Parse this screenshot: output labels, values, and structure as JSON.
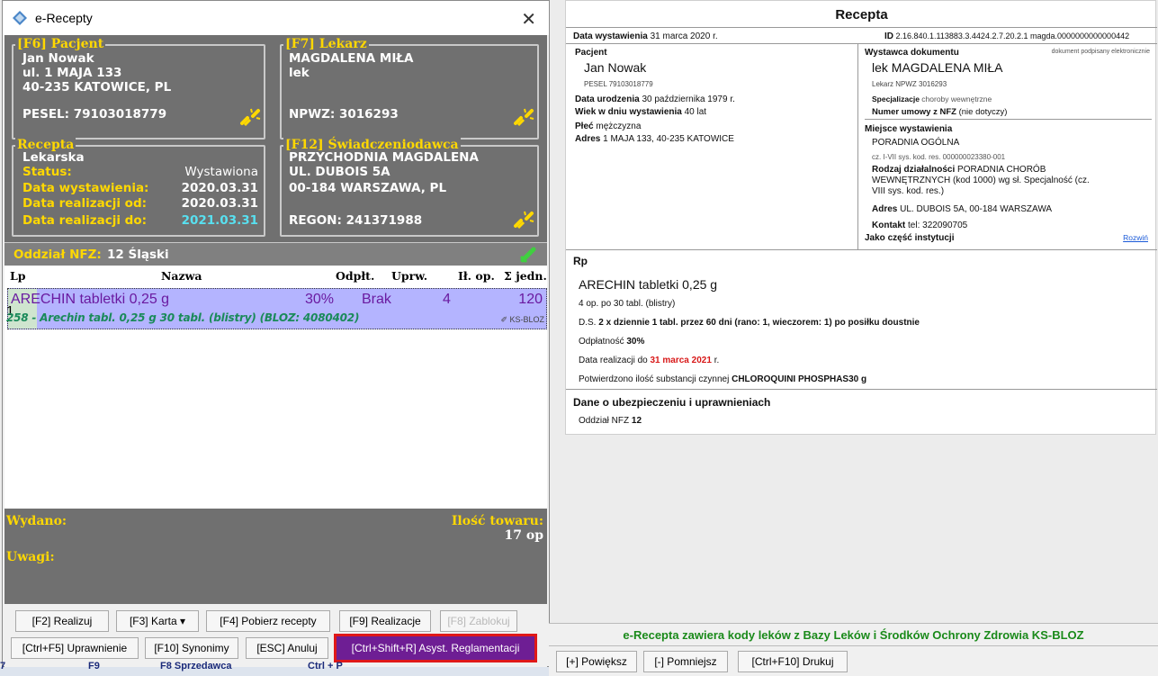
{
  "window": {
    "title": "e-Recepty"
  },
  "patient": {
    "legend": "[F6] Pacjent",
    "name": "Jan Nowak",
    "street": "ul. 1 MAJA 133",
    "city": "40-235 KATOWICE, PL",
    "pesel": "PESEL: 79103018779"
  },
  "doctor": {
    "legend": "[F7] Lekarz",
    "name": "MAGDALENA MIŁA",
    "title": "lek",
    "npwz": "NPWZ: 3016293"
  },
  "prescription": {
    "legend": "Recepta",
    "type": "Lekarska",
    "status_label": "Status:",
    "status_value": "Wystawiona",
    "issued_label": "Data wystawienia:",
    "issued_value": "2020.03.31",
    "from_label": "Data realizacji od:",
    "from_value": "2020.03.31",
    "to_label": "Data realizacji do:",
    "to_value": "2021.03.31"
  },
  "provider": {
    "legend": "[F12] Świadczeniodawca",
    "name": "PRZYCHODNIA MAGDALENA",
    "street": "UL. DUBOIS 5A",
    "city": "00-184 WARSZAWA, PL",
    "regon": "REGON: 241371988"
  },
  "nfz": {
    "label": "Oddział NFZ:",
    "value": "12 Śląski"
  },
  "table": {
    "headers": {
      "lp": "Lp",
      "name": "Nazwa",
      "odplt": "Odpłt.",
      "uprw": "Uprw.",
      "ilop": "Ił. op.",
      "sum": "Σ jedn."
    },
    "rows": [
      {
        "lp": "1",
        "name": "ARECHIN tabletki 0,25 g",
        "odplt": "30%",
        "uprw": "Brak",
        "ilop": "4",
        "sum": "120",
        "detail": "258 - Arechin tabl. 0,25 g 30 tabl. (blistry) (BLOZ: 4080402)",
        "tag": "KS-BLOZ"
      }
    ]
  },
  "bottom": {
    "wydano": "Wydano:",
    "ilosc_label": "Ilość towaru:",
    "ilosc_value": "17 op",
    "uwagi": "Uwagi:"
  },
  "buttons": {
    "realizuj": "[F2] Realizuj",
    "karta": "[F3] Karta ▾",
    "pobierz": "[F4] Pobierz recepty",
    "realizacje": "[F9] Realizacje",
    "zablokuj": "[F8] Zablokuj",
    "uprawnienie": "[Ctrl+F5] Uprawnienie",
    "synonimy": "[F10] Synonimy",
    "anuluj": "[ESC] Anuluj",
    "asyst": "[Ctrl+Shift+R] Asyst. Reglamentacji"
  },
  "taskbar": {
    "f9": "F9",
    "f8": "F8 Sprzedawca",
    "ctrlp": "Ctrl + P",
    "f7": "7"
  },
  "doc": {
    "title": "Recepta",
    "date_label": "Data wystawienia",
    "date_value": "31 marca 2020 r.",
    "id_label": "ID",
    "id_value": "2.16.840.1.113883.3.4424.2.7.20.2.1 magda.0000000000000442",
    "patient": {
      "heading": "Pacjent",
      "name": "Jan Nowak",
      "pesel": "PESEL 79103018779",
      "birth_label": "Data urodzenia",
      "birth_value": "30 października 1979 r.",
      "age_label": "Wiek w dniu wystawienia",
      "age_value": "40 lat",
      "sex_label": "Płeć",
      "sex_value": "mężczyzna",
      "addr_label": "Adres",
      "addr_value": "1 MAJA 133, 40-235 KATOWICE"
    },
    "issuer": {
      "heading": "Wystawca dokumentu",
      "signed": "dokument podpisany elektronicznie",
      "name": "lek MAGDALENA MIŁA",
      "npwz": "Lekarz NPWZ 3016293",
      "spec_label": "Specjalizacje",
      "spec_value": "choroby wewnętrzne",
      "contract_label": "Numer umowy z NFZ",
      "contract_value": "(nie dotyczy)",
      "place_heading": "Miejsce wystawienia",
      "place_name": "PORADNIA OGÓLNA",
      "place_code": "cz. I-VII sys. kod. res. 000000023380-001",
      "activity_label": "Rodzaj działalności",
      "activity_line1": "PORADNIA CHORÓB",
      "activity_line2": "WEWNĘTRZNYCH (kod 1000) wg sł. Specjalność (cz.",
      "activity_line3": "VIII sys. kod. res.)",
      "addr_label": "Adres",
      "addr_value": "UL. DUBOIS 5A, 00-184 WARSZAWA",
      "contact_label": "Kontakt",
      "contact_value": "tel: 322090705",
      "inst_label": "Jako część instytucji",
      "expand": "Rozwiń"
    },
    "rp": {
      "heading": "Rp",
      "drug": "ARECHIN tabletki 0,25 g",
      "pack": "4 op. po 30 tabl. (blistry)",
      "ds_label": "D.S.",
      "ds_value": "2 x dziennie 1 tabl. przez 60 dni (rano: 1, wieczorem: 1) po posiłku doustnie",
      "refund_label": "Odpłatność",
      "refund_value": "30%",
      "valid_label": "Data realizacji do",
      "valid_value": "31 marca 2021",
      "valid_suffix": "r.",
      "confirm_label": "Potwierdzono ilość substancji czynnej",
      "confirm_value": "CHLOROQUINI PHOSPHAS30 g"
    },
    "insurance": {
      "heading": "Dane o ubezpieczeniu i uprawnieniach",
      "nfz_label": "Oddział NFZ",
      "nfz_value": "12"
    }
  },
  "footer": {
    "info": "e-Recepta zawiera kody leków z Bazy Leków i Środków Ochrony Zdrowia KS-BLOZ",
    "zoom_in": "[+] Powiększ",
    "zoom_out": "[-] Pomniejsz",
    "print": "[Ctrl+F10] Drukuj"
  },
  "colors": {
    "panel": "#707070",
    "legend": "#ffd800",
    "row_highlight": "#b4b4ff",
    "detail_green": "#1a8a5a",
    "drug_purple": "#6a1aa0",
    "highlight_button": "#6e1e94",
    "red": "#e01818"
  }
}
